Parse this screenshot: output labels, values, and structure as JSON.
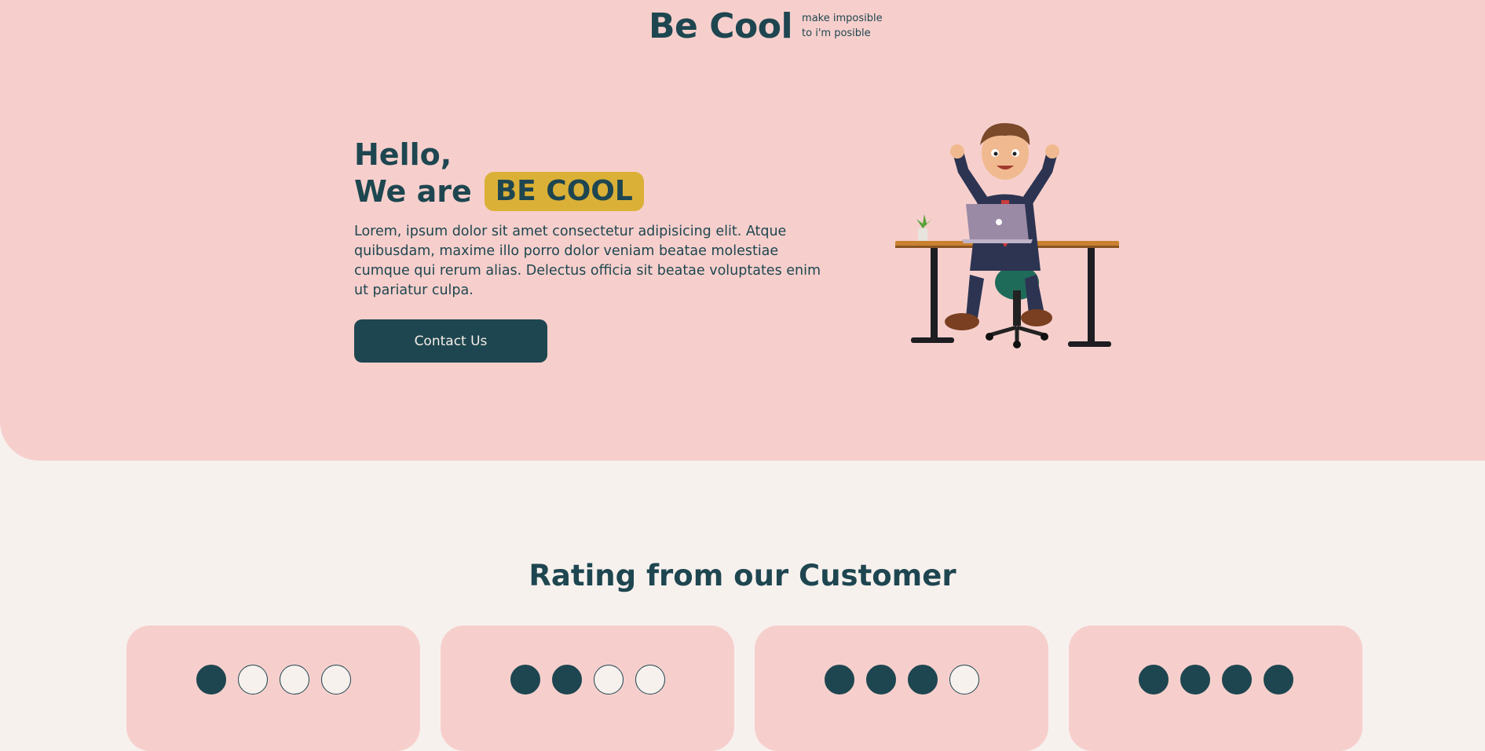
{
  "brand": {
    "name": "Be Cool",
    "tagline_line1": "make imposible",
    "tagline_line2": "to i'm posible"
  },
  "hero": {
    "greeting": "Hello,",
    "we_are": "We are",
    "highlight": "BE COOL",
    "description": "Lorem, ipsum dolor sit amet consectetur adipisicing elit. Atque quibusdam, maxime illo porro dolor veniam beatae molestiae cumque qui rerum alias. Delectus officia sit beatae voluptates enim ut pariatur culpa.",
    "cta_label": "Contact Us",
    "illustration": "businessman-at-desk-cheering"
  },
  "ratings": {
    "title": "Rating from our Customer",
    "cards": [
      {
        "filled": 1,
        "total": 4
      },
      {
        "filled": 2,
        "total": 4
      },
      {
        "filled": 3,
        "total": 4
      },
      {
        "filled": 4,
        "total": 4
      }
    ]
  },
  "colors": {
    "primary": "#1e4650",
    "hero_bg": "#f6cfcc",
    "page_bg": "#f7f1ee",
    "accent": "#dbb036"
  }
}
